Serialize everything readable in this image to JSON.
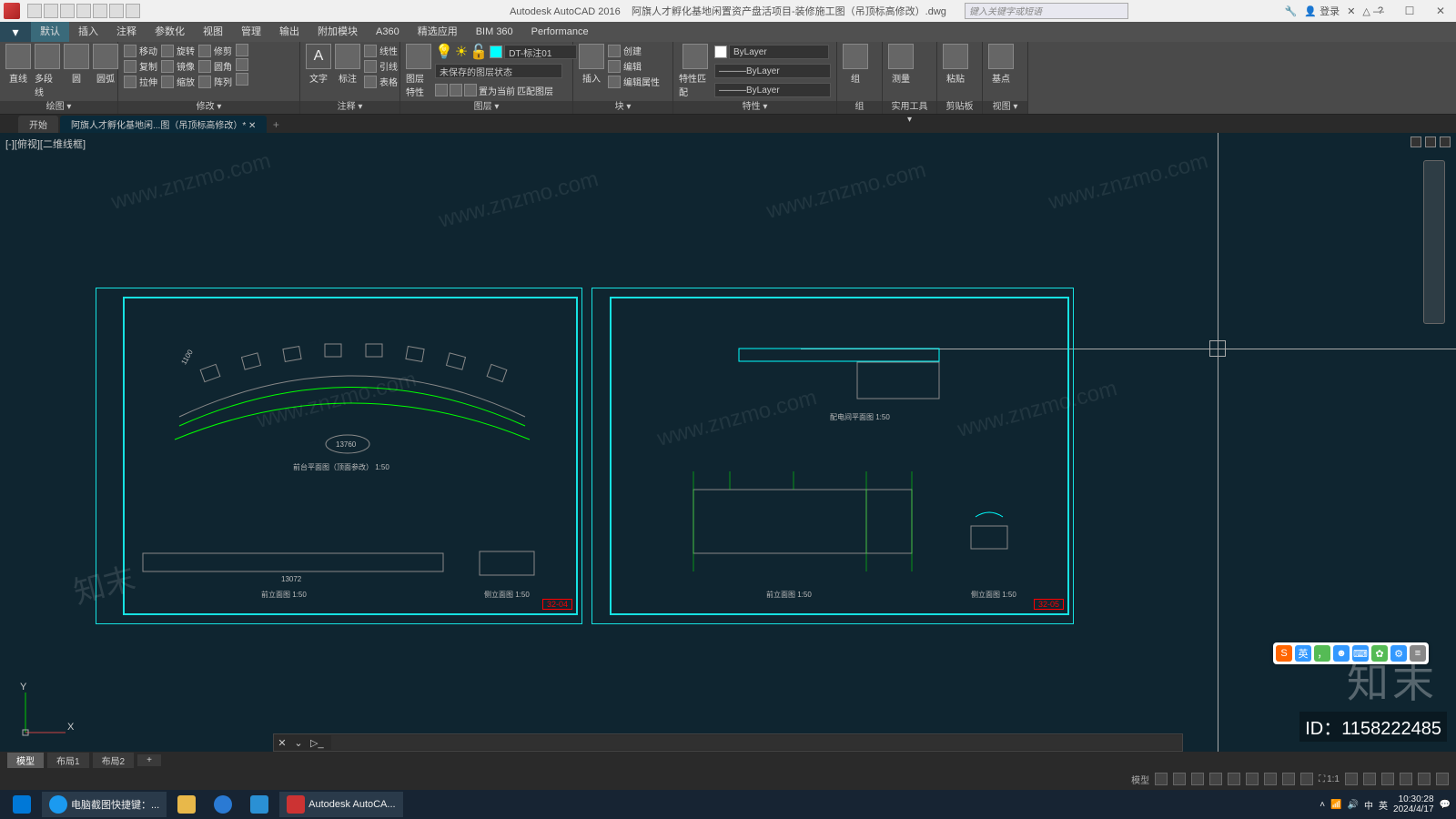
{
  "title": {
    "app": "Autodesk AutoCAD 2016",
    "file": "阿旗人才孵化基地闲置资产盘活项目-装修施工图（吊顶标高修改）.dwg"
  },
  "search_placeholder": "键入关键字或短语",
  "login": "登录",
  "menu": [
    "默认",
    "插入",
    "注释",
    "参数化",
    "视图",
    "管理",
    "输出",
    "附加模块",
    "A360",
    "精选应用",
    "BIM 360",
    "Performance"
  ],
  "ribbon": {
    "draw": {
      "label": "绘图 ▾",
      "line": "直线",
      "polyline": "多段线",
      "circle": "圆",
      "arc": "圆弧"
    },
    "modify": {
      "label": "修改 ▾",
      "move": "移动",
      "rotate": "旋转",
      "trim": "修剪",
      "copy": "复制",
      "mirror": "镜像",
      "fillet": "圆角",
      "stretch": "拉伸",
      "scale": "缩放",
      "array": "阵列"
    },
    "anno": {
      "label": "注释 ▾",
      "text": "文字",
      "dim": "标注",
      "linear": "线性",
      "leader": "引线",
      "table": "表格"
    },
    "layer": {
      "label": "图层 ▾",
      "props": "图层特性",
      "current": "DT-标注01",
      "unsaved": "未保存的图层状态",
      "match": "匹配图层",
      "set": "置为当前"
    },
    "block": {
      "label": "块 ▾",
      "insert": "插入",
      "create": "创建",
      "edit": "编辑",
      "edit_attr": "编辑属性"
    },
    "props": {
      "label": "特性 ▾",
      "match": "特性匹配",
      "bylayer": "ByLayer"
    },
    "group": {
      "label": "组",
      "group": "组"
    },
    "util": {
      "label": "实用工具 ▾",
      "measure": "测量"
    },
    "clip": {
      "label": "剪贴板",
      "paste": "粘贴"
    },
    "view": {
      "label": "视图 ▾",
      "base": "基点"
    }
  },
  "file_tabs": {
    "start": "开始",
    "doc": "阿旗人才孵化基地闲...图（吊顶标高修改）*"
  },
  "viewport_label": "[-][俯视][二维线框]",
  "drawing": {
    "dim1": "1100",
    "dim2": "13760",
    "dim3": "13072",
    "title1": "前台平面图（顶面参改） 1:50",
    "title2": "前立面图 1:50",
    "title3": "侧立面图 1:50",
    "title4": "配电间平面图 1:50",
    "title5": "前立面图 1:50",
    "title6": "侧立面图 1:50",
    "tag1": "32-04",
    "tag2": "32-05"
  },
  "ucs": {
    "x": "X",
    "y": "Y"
  },
  "model_tabs": [
    "模型",
    "布局1",
    "布局2"
  ],
  "status": {
    "model": "模型",
    "ratio": "1:1"
  },
  "taskbar": {
    "app1": "电脑截图快捷键：...",
    "app2": "Autodesk AutoCA...",
    "time": "10:30:28",
    "date": "2024/4/17",
    "lang1": "中",
    "lang2": "英"
  },
  "watermark": "www.znzmo.com",
  "wm_brand": "知末",
  "wm_id": "ID：1158222485",
  "ime_label": "英"
}
